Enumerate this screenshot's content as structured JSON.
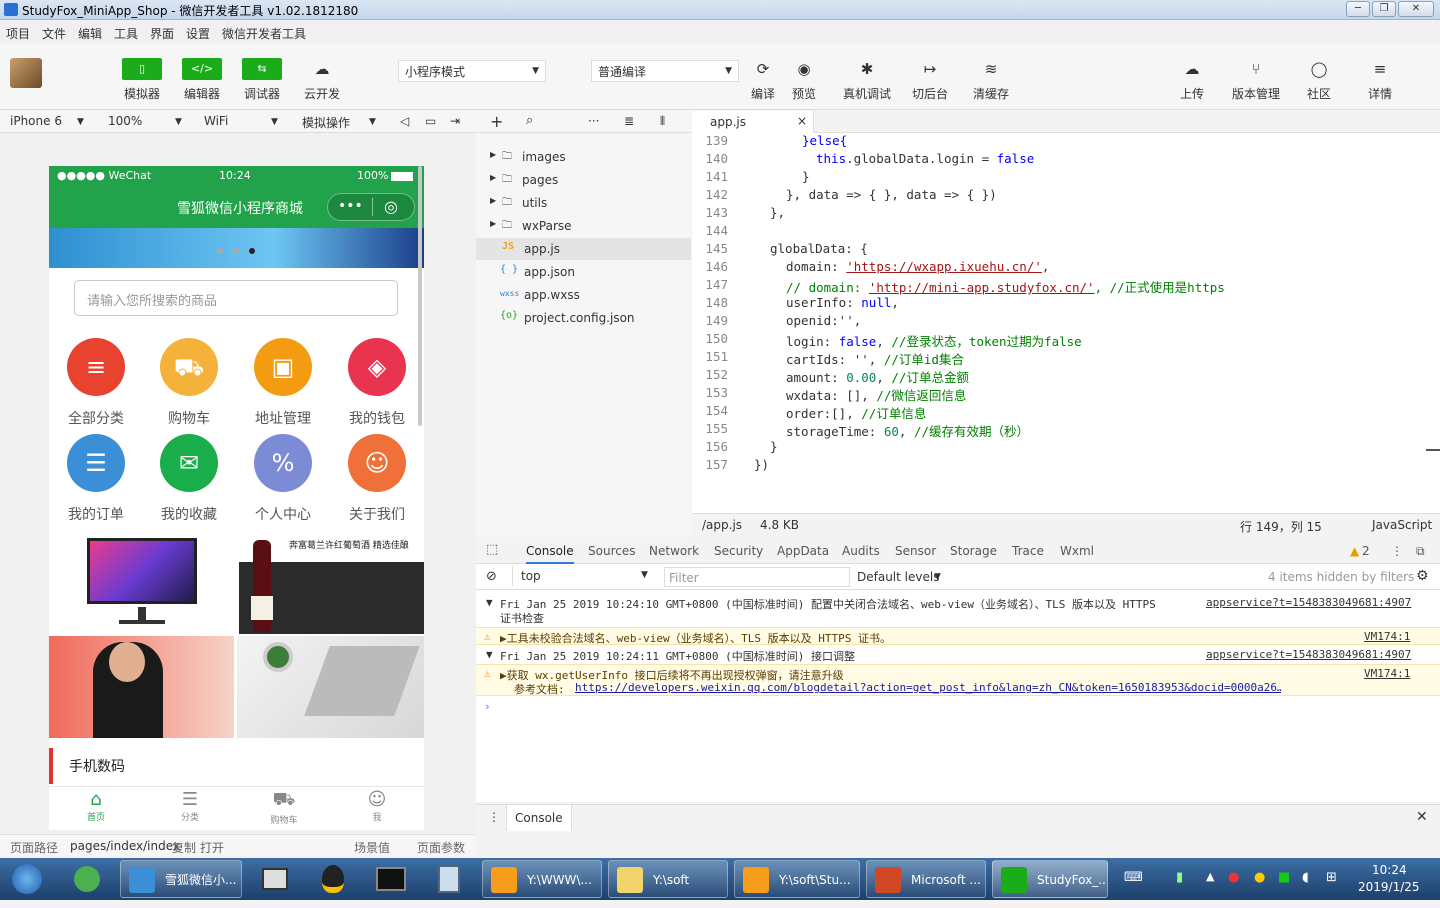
{
  "window": {
    "title": "StudyFox_MiniApp_Shop - 微信开发者工具 v1.02.1812180"
  },
  "menu": [
    "项目",
    "文件",
    "编辑",
    "工具",
    "界面",
    "设置",
    "微信开发者工具"
  ],
  "toolbar": {
    "simulator": "模拟器",
    "editor": "编辑器",
    "debugger": "调试器",
    "cloud": "云开发",
    "mode": "小程序模式",
    "compile_mode": "普通编译",
    "compile": "编译",
    "preview": "预览",
    "remote_debug": "真机调试",
    "background": "切后台",
    "clear_cache": "清缓存",
    "upload": "上传",
    "version": "版本管理",
    "community": "社区",
    "details": "详情"
  },
  "simbar": {
    "device": "iPhone 6",
    "zoom": "100%",
    "network": "WiFi",
    "ops": "模拟操作"
  },
  "phone": {
    "carrier": "●●●●● WeChat",
    "time": "10:24",
    "battery": "100%",
    "nav_title": "雪狐微信小程序商城",
    "search_placeholder": "请输入您所搜索的商品",
    "categories": [
      {
        "label": "全部分类",
        "color": "#e7432f",
        "icon": "≡"
      },
      {
        "label": "购物车",
        "color": "#f5a623",
        "icon": "🛒"
      },
      {
        "label": "地址管理",
        "color": "#f39c12",
        "icon": "▣"
      },
      {
        "label": "我的钱包",
        "color": "#e8344e",
        "icon": "◈"
      },
      {
        "label": "我的订单",
        "color": "#3a8fd6",
        "icon": "☰"
      },
      {
        "label": "我的收藏",
        "color": "#1aad4b",
        "icon": "✉"
      },
      {
        "label": "个人中心",
        "color": "#7b8bd6",
        "icon": "%"
      },
      {
        "label": "关于我们",
        "color": "#f0703a",
        "icon": "☺"
      }
    ],
    "wine_caption": "奔富葛兰许红葡萄酒 精选佳酿",
    "section_title": "手机数码",
    "tabs": [
      "首页",
      "分类",
      "购物车",
      "我"
    ]
  },
  "pathbar": {
    "label": "页面路径",
    "path": "pages/index/index",
    "copy": "复制",
    "open": "打开",
    "scene": "场景值",
    "params": "页面参数"
  },
  "files": [
    {
      "name": "images",
      "type": "folder"
    },
    {
      "name": "pages",
      "type": "folder"
    },
    {
      "name": "utils",
      "type": "folder"
    },
    {
      "name": "wxParse",
      "type": "folder"
    },
    {
      "name": "app.js",
      "type": "js",
      "icon": "JS"
    },
    {
      "name": "app.json",
      "type": "json",
      "icon": "{ }"
    },
    {
      "name": "app.wxss",
      "type": "wxss",
      "icon": "wxss"
    },
    {
      "name": "project.config.json",
      "type": "json",
      "icon": "{o}"
    }
  ],
  "editor": {
    "tab": "app.js",
    "lines": [
      "139",
      "140",
      "141",
      "142",
      "143",
      "144",
      "145",
      "146",
      "147",
      "148",
      "149",
      "150",
      "151",
      "152",
      "153",
      "154",
      "155",
      "156",
      "157"
    ],
    "code": {
      "l139": "}else{",
      "l140a": "this",
      ".l140b": "",
      "l140": ".globalData.login = ",
      "l140v": "false",
      "l141": "}",
      "l142": "}, data => { }, data => { })",
      "l143": "},",
      "l145": "globalData: {",
      "l146k": "domain: ",
      "l146v": "'https://wxapp.ixuehu.cn/'",
      "l146e": ",",
      "l147c": "// domain: ",
      "l147v": "'http://mini-app.studyfox.cn/'",
      "l147c2": ", //正式使用是https",
      "l148k": "userInfo: ",
      "l148v": "null",
      "l148e": ",",
      "l149": "openid:'',",
      "l150k": "login: ",
      "l150v": "false",
      "l150e": ", ",
      "l150c": "//登录状态，token过期为false",
      "l151k": "cartIds: '', ",
      "l151c": "//订单id集合",
      "l152k": "amount: ",
      "l152v": "0.00",
      "l152e": ", ",
      "l152c": "//订单总金额",
      "l153k": "wxdata: [], ",
      "l153c": "//微信返回信息",
      "l154k": "order:[], ",
      "l154c": "//订单信息",
      "l155k": "storageTime: ",
      "l155v": "60",
      "l155e": ", ",
      "l155c": "//缓存有效期（秒）",
      "l156": "}",
      "l157": "})"
    },
    "status": {
      "path": "/app.js",
      "size": "4.8 KB",
      "position": "行 149，列 15",
      "lang": "JavaScript"
    }
  },
  "devtools": {
    "tabs": [
      "Console",
      "Sources",
      "Network",
      "Security",
      "AppData",
      "Audits",
      "Sensor",
      "Storage",
      "Trace",
      "Wxml"
    ],
    "warn_count": "2",
    "context": "top",
    "filter_placeholder": "Filter",
    "levels": "Default levels",
    "hidden": "4 items hidden by filters",
    "log1": "Fri Jan 25 2019 10:24:10 GMT+0800 (中国标准时间) 配置中关闭合法域名、web-view（业务域名）、TLS 版本以及 HTTPS",
    "log1b": "证书检查",
    "log1src": "appservice?t=1548383049681:4907",
    "warn1": "▶工具未校验合法域名、web-view（业务域名）、TLS 版本以及 HTTPS 证书。",
    "warn1src": "VM174:1",
    "log2": "Fri Jan 25 2019 10:24:11 GMT+0800 (中国标准时间) 接口调整",
    "log2src": "appservice?t=1548383049681:4907",
    "warn2": "▶获取 wx.getUserInfo 接口后续将不再出现授权弹窗，请注意升级",
    "warn2src": "VM174:1",
    "warn2b": "参考文档:",
    "warn2link": "https://developers.weixin.qq.com/blogdetail?action=get_post_info&lang=zh_CN&token=1650183953&docid=0000a26…",
    "drawer": "Console"
  },
  "taskbar": {
    "items": [
      "雪狐微信小...",
      "Y:\\WWW\\...",
      "Y:\\soft",
      "Y:\\soft\\Stu...",
      "Microsoft ...",
      "StudyFox_..."
    ],
    "time": "10:24",
    "date": "2019/1/25"
  }
}
